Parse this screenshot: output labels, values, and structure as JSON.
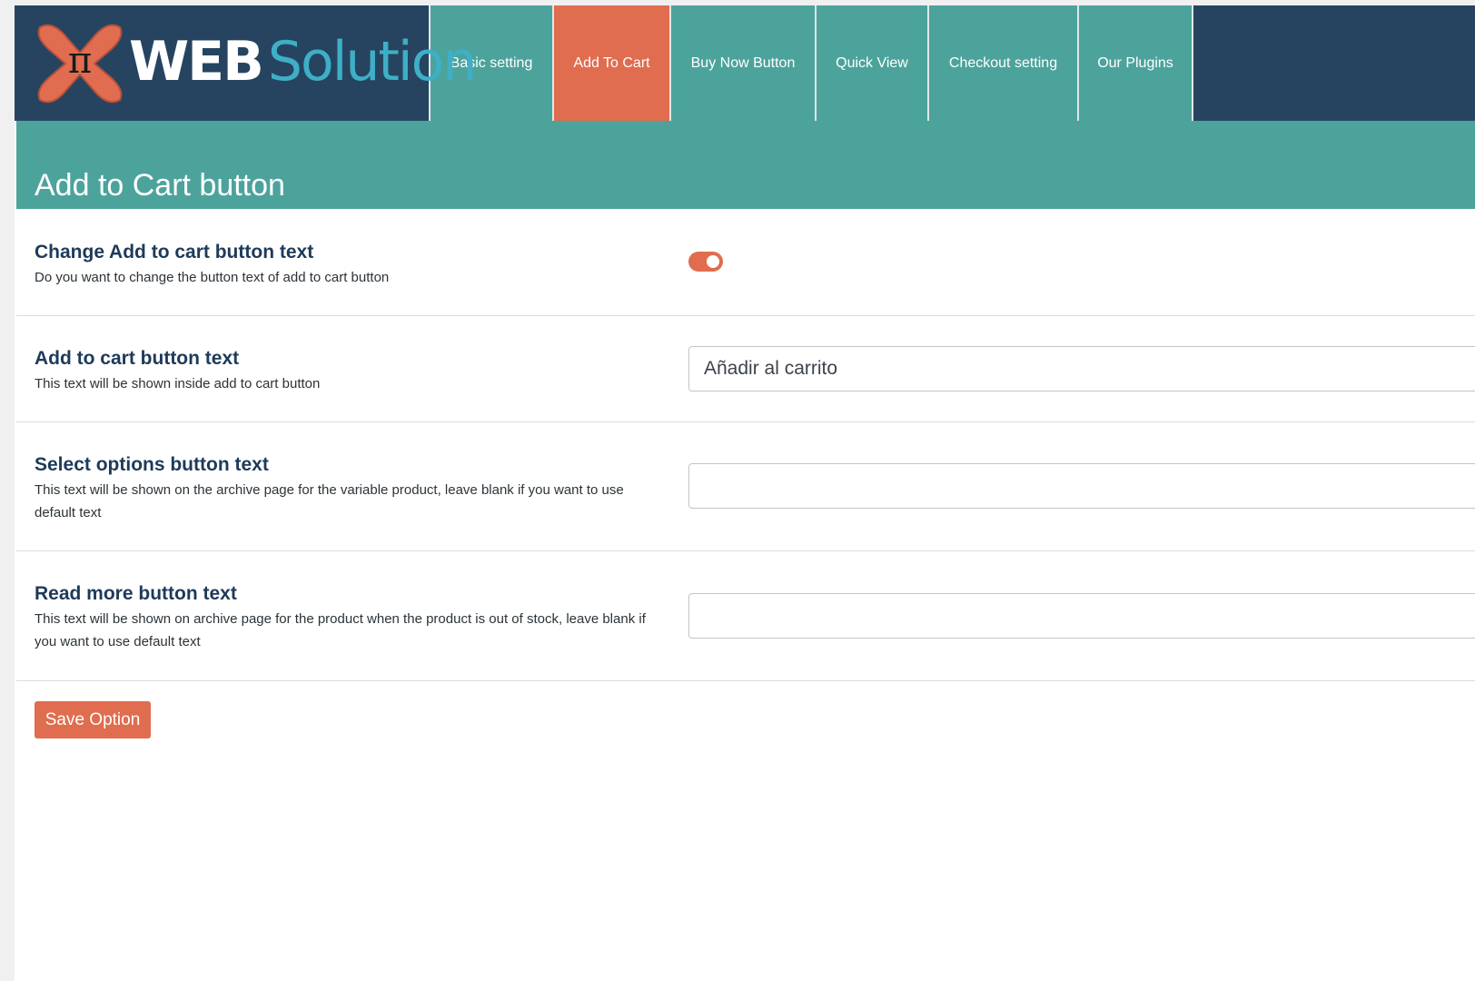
{
  "brand": {
    "logo_web": "WEB",
    "logo_solution": "Solution",
    "logo_symbol": "π",
    "colors": {
      "navy": "#264460",
      "teal": "#4ca39c",
      "orange": "#e06d4f",
      "light_blue": "#3eafc6"
    }
  },
  "nav": {
    "tabs": [
      {
        "label": "Basic setting",
        "active": false
      },
      {
        "label": "Add To Cart",
        "active": true
      },
      {
        "label": "Buy Now Button",
        "active": false
      },
      {
        "label": "Quick View",
        "active": false
      },
      {
        "label": "Checkout setting",
        "active": false
      },
      {
        "label": "Our Plugins",
        "active": false
      }
    ]
  },
  "page": {
    "title": "Add to Cart button"
  },
  "settings": {
    "change_text": {
      "title": "Change Add to cart button text",
      "description": "Do you want to change the button text of add to cart button",
      "enabled": true
    },
    "add_to_cart_text": {
      "title": "Add to cart button text",
      "description": "This text will be shown inside add to cart button",
      "value": "Añadir al carrito"
    },
    "select_options_text": {
      "title": "Select options button text",
      "description": "This text will be shown on the archive page for the variable product, leave blank if you want to use default text",
      "value": ""
    },
    "read_more_text": {
      "title": "Read more button text",
      "description": "This text will be shown on archive page for the product when the product is out of stock, leave blank if you want to use default text",
      "value": ""
    }
  },
  "actions": {
    "save_label": "Save Option"
  }
}
